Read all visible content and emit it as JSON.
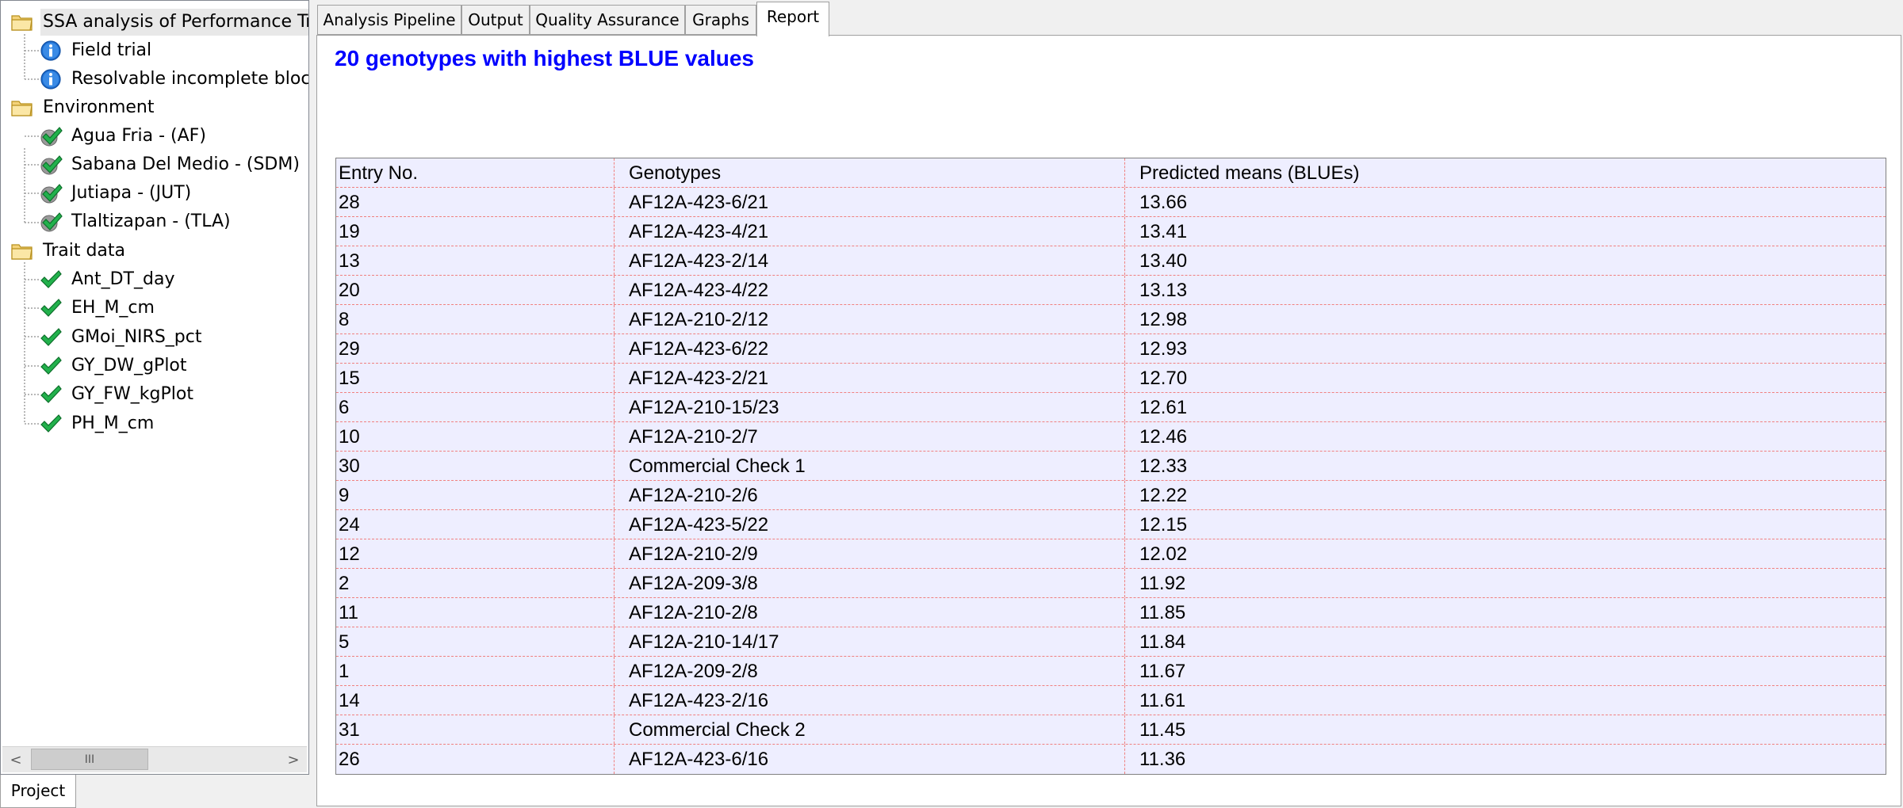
{
  "tree": {
    "root_label": "SSA analysis of Performance Tr",
    "design_items": [
      "Field trial",
      "Resolvable incomplete bloc"
    ],
    "environment_label": "Environment",
    "environments": [
      "Agua Fria - (AF)",
      "Sabana Del Medio - (SDM)",
      "Jutiapa - (JUT)",
      "Tlaltizapan - (TLA)"
    ],
    "trait_label": "Trait data",
    "traits": [
      "Ant_DT_day",
      "EH_M_cm",
      "GMoi_NIRS_pct",
      "GY_DW_gPlot",
      "GY_FW_kgPlot",
      "PH_M_cm"
    ]
  },
  "scrollbar": {
    "left_arrow": "<",
    "right_arrow": ">",
    "thumb": "III"
  },
  "bottom_tab": "Project",
  "tabs": [
    "Analysis Pipeline",
    "Output",
    "Quality Assurance",
    "Graphs",
    "Report"
  ],
  "active_tab": "Report",
  "report": {
    "title": "20 genotypes with highest BLUE values",
    "headers": [
      "Entry No.",
      "Genotypes",
      "Predicted means (BLUEs)"
    ],
    "rows": [
      [
        "28",
        "AF12A-423-6/21",
        "13.66"
      ],
      [
        "19",
        "AF12A-423-4/21",
        "13.41"
      ],
      [
        "13",
        "AF12A-423-2/14",
        "13.40"
      ],
      [
        "20",
        "AF12A-423-4/22",
        "13.13"
      ],
      [
        "8",
        "AF12A-210-2/12",
        "12.98"
      ],
      [
        "29",
        "AF12A-423-6/22",
        "12.93"
      ],
      [
        "15",
        "AF12A-423-2/21",
        "12.70"
      ],
      [
        "6",
        "AF12A-210-15/23",
        "12.61"
      ],
      [
        "10",
        "AF12A-210-2/7",
        "12.46"
      ],
      [
        "30",
        "Commercial Check 1",
        "12.33"
      ],
      [
        "9",
        "AF12A-210-2/6",
        "12.22"
      ],
      [
        "24",
        "AF12A-423-5/22",
        "12.15"
      ],
      [
        "12",
        "AF12A-210-2/9",
        "12.02"
      ],
      [
        "2",
        "AF12A-209-3/8",
        "11.92"
      ],
      [
        "11",
        "AF12A-210-2/8",
        "11.85"
      ],
      [
        "5",
        "AF12A-210-14/17",
        "11.84"
      ],
      [
        "1",
        "AF12A-209-2/8",
        "11.67"
      ],
      [
        "14",
        "AF12A-423-2/16",
        "11.61"
      ],
      [
        "31",
        "Commercial Check 2",
        "11.45"
      ],
      [
        "26",
        "AF12A-423-6/16",
        "11.36"
      ]
    ]
  },
  "colors": {
    "title": "#0000ff",
    "table_bg": "#eeeeff",
    "grid_dash": "#f08080",
    "check": "#22b14c"
  }
}
